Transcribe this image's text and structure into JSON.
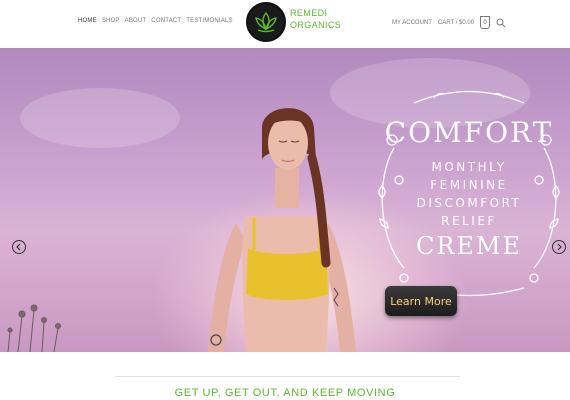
{
  "header": {
    "nav_left": [
      "HOME",
      "SHOP",
      "ABOUT",
      "CONTACT",
      "TESTIMONIALS"
    ],
    "logo_line1": "REMEDI",
    "logo_line2": "ORGANICS",
    "my_account": "MY ACCOUNT",
    "cart": "CART / $0.00",
    "cart_count": "0"
  },
  "hero": {
    "promo_title": "COMFORT",
    "promo_line1": "MONTHLY",
    "promo_line2": "FEMININE",
    "promo_line3": "DISCOMFORT",
    "promo_line4": "RELIEF",
    "promo_product": "CREME",
    "cta_label": "Learn More",
    "slide_count": 2,
    "active_slide": 2
  },
  "section": {
    "tagline": "GET UP, GET OUT, AND KEEP MOVING"
  },
  "colors": {
    "brand_green": "#5fb82e",
    "hero_purple": "#c9a0cf",
    "cta_text": "#f4d27a"
  }
}
